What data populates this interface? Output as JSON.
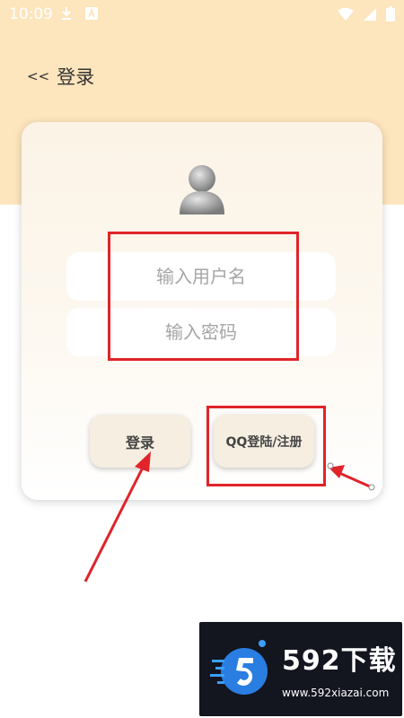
{
  "status_bar": {
    "time": "10:09",
    "left_icons": [
      "download-icon",
      "a-icon"
    ],
    "right_icons": [
      "wifi-icon",
      "signal-icon",
      "battery-icon"
    ]
  },
  "header": {
    "back_label": "<<",
    "title": "登录"
  },
  "form": {
    "username_placeholder": "输入用户名",
    "password_placeholder": "输入密码",
    "login_label": "登录",
    "qq_label": "QQ登陆/注册"
  },
  "watermark": {
    "brand": "592下载",
    "url": "www.592xiazai.com"
  },
  "colors": {
    "header_bg": "#fde5bd",
    "card_bg": "#fbf3e6",
    "button_bg": "#f5eee1",
    "annotation_red": "#e0242a"
  }
}
